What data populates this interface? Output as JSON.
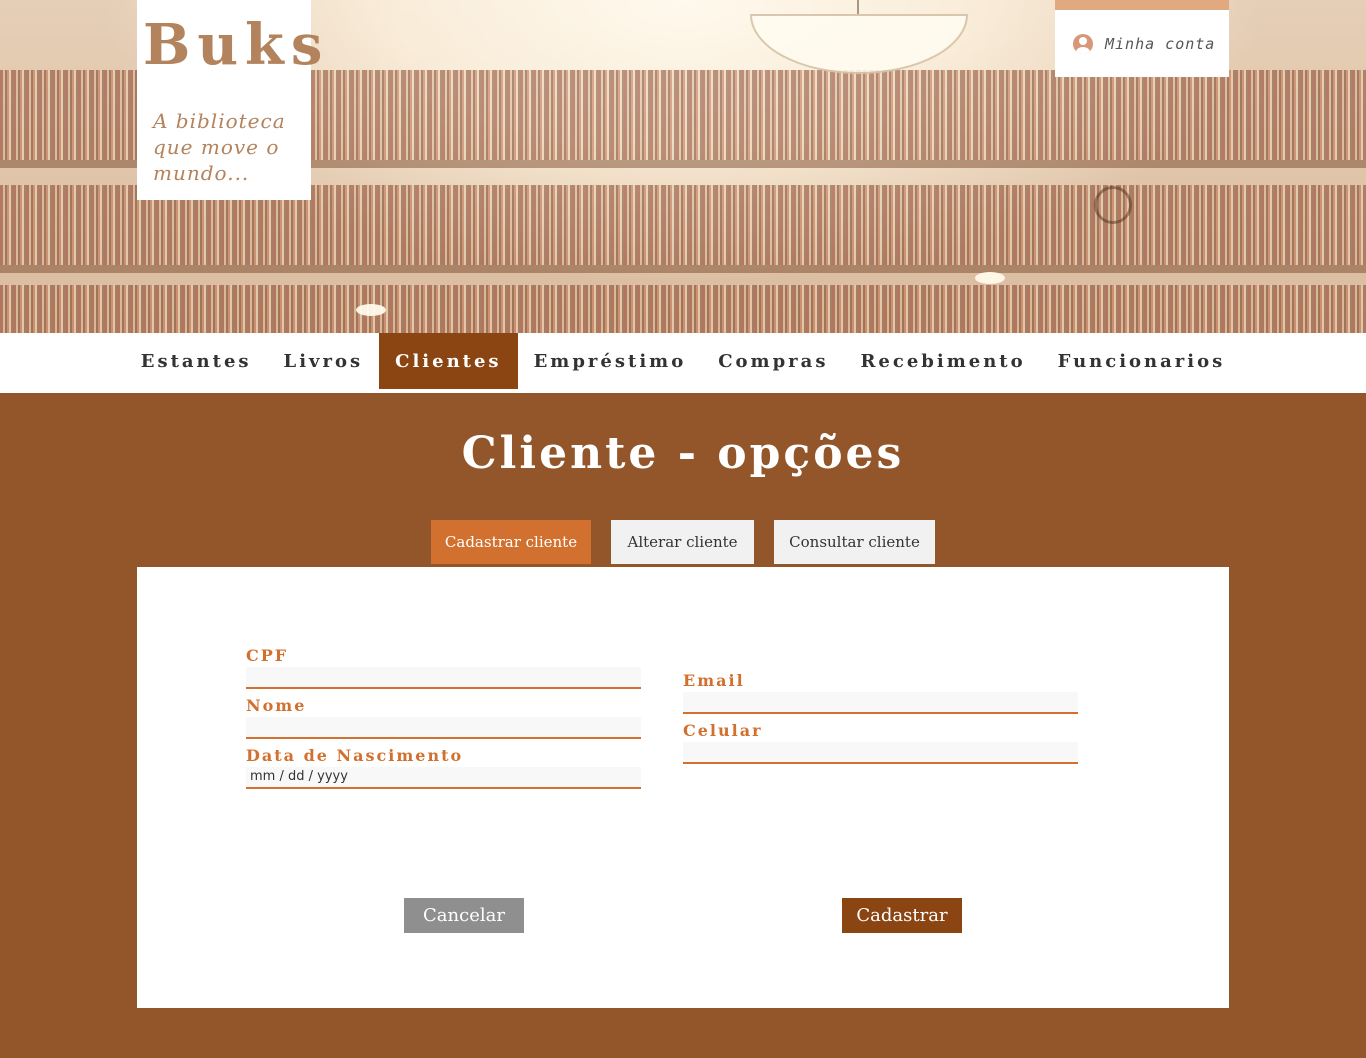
{
  "brand": {
    "title": "Buks",
    "tagline": "A biblioteca que move o mundo..."
  },
  "account": {
    "icon": "user-circle-icon",
    "label": "Minha conta"
  },
  "nav": {
    "items": [
      {
        "label": "Estantes"
      },
      {
        "label": "Livros"
      },
      {
        "label": "Clientes",
        "active": true
      },
      {
        "label": "Empréstimo"
      },
      {
        "label": "Compras"
      },
      {
        "label": "Recebimento"
      },
      {
        "label": "Funcionarios"
      }
    ]
  },
  "page": {
    "title": "Cliente - opções"
  },
  "tabs": {
    "items": [
      {
        "label": "Cadastrar cliente",
        "active": true
      },
      {
        "label": "Alterar cliente"
      },
      {
        "label": "Consultar cliente"
      }
    ]
  },
  "form": {
    "cpf_label": "CPF",
    "cpf_value": "",
    "nome_label": "Nome",
    "nome_value": "",
    "nascimento_label": "Data de Nascimento",
    "nascimento_placeholder": "mm / dd / yyyy",
    "email_label": "Email",
    "email_value": "",
    "celular_label": "Celular",
    "celular_value": "",
    "cancel_label": "Cancelar",
    "submit_label": "Cadastrar"
  },
  "colors": {
    "primary_brown": "#8b4513",
    "page_background": "#93552a",
    "accent_orange": "#d2702f",
    "logo_tan": "#b3835d",
    "cancel_gray": "#8f8f8f"
  }
}
